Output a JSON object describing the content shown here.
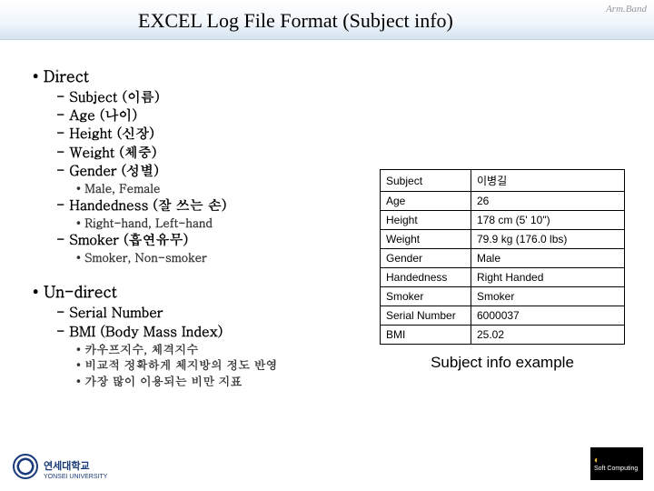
{
  "header": {
    "title": "EXCEL Log File Format (Subject info)",
    "watermark": "Arm.Band"
  },
  "sections": {
    "direct": {
      "heading": "Direct",
      "subject": "Subject (이름)",
      "age": "Age (나이)",
      "height": "Height (신장)",
      "weight": "Weight (체중)",
      "gender": "Gender (성별)",
      "gender_vals": "Male, Female",
      "handed": "Handedness (잘 쓰는 손)",
      "handed_vals": "Right-hand, Left-hand",
      "smoker": "Smoker (흡연유무)",
      "smoker_vals": "Smoker, Non-smoker"
    },
    "undirect": {
      "heading": "Un-direct",
      "serial": "Serial Number",
      "bmi": "BMI (Body Mass Index)",
      "bmi_d1": "카우프지수, 체격지수",
      "bmi_d2": "비교적 정확하게 체지방의 정도 반영",
      "bmi_d3": "가장 많이 이용되는 비만 지표"
    }
  },
  "table": {
    "rows": [
      {
        "k": "Subject",
        "v": "이병길"
      },
      {
        "k": "Age",
        "v": "26"
      },
      {
        "k": "Height",
        "v": "178 cm (5' 10\")"
      },
      {
        "k": "Weight",
        "v": "79.9 kg (176.0 lbs)"
      },
      {
        "k": "Gender",
        "v": "Male"
      },
      {
        "k": "Handedness",
        "v": "Right Handed"
      },
      {
        "k": "Smoker",
        "v": "Smoker"
      },
      {
        "k": "Serial Number",
        "v": "6000037"
      },
      {
        "k": "BMI",
        "v": "25.02"
      }
    ],
    "caption": "Subject info example"
  },
  "footer": {
    "uni_ko": "연세대학교",
    "uni_en": "YONSEI UNIVERSITY",
    "lab": "Soft\nComputing"
  }
}
